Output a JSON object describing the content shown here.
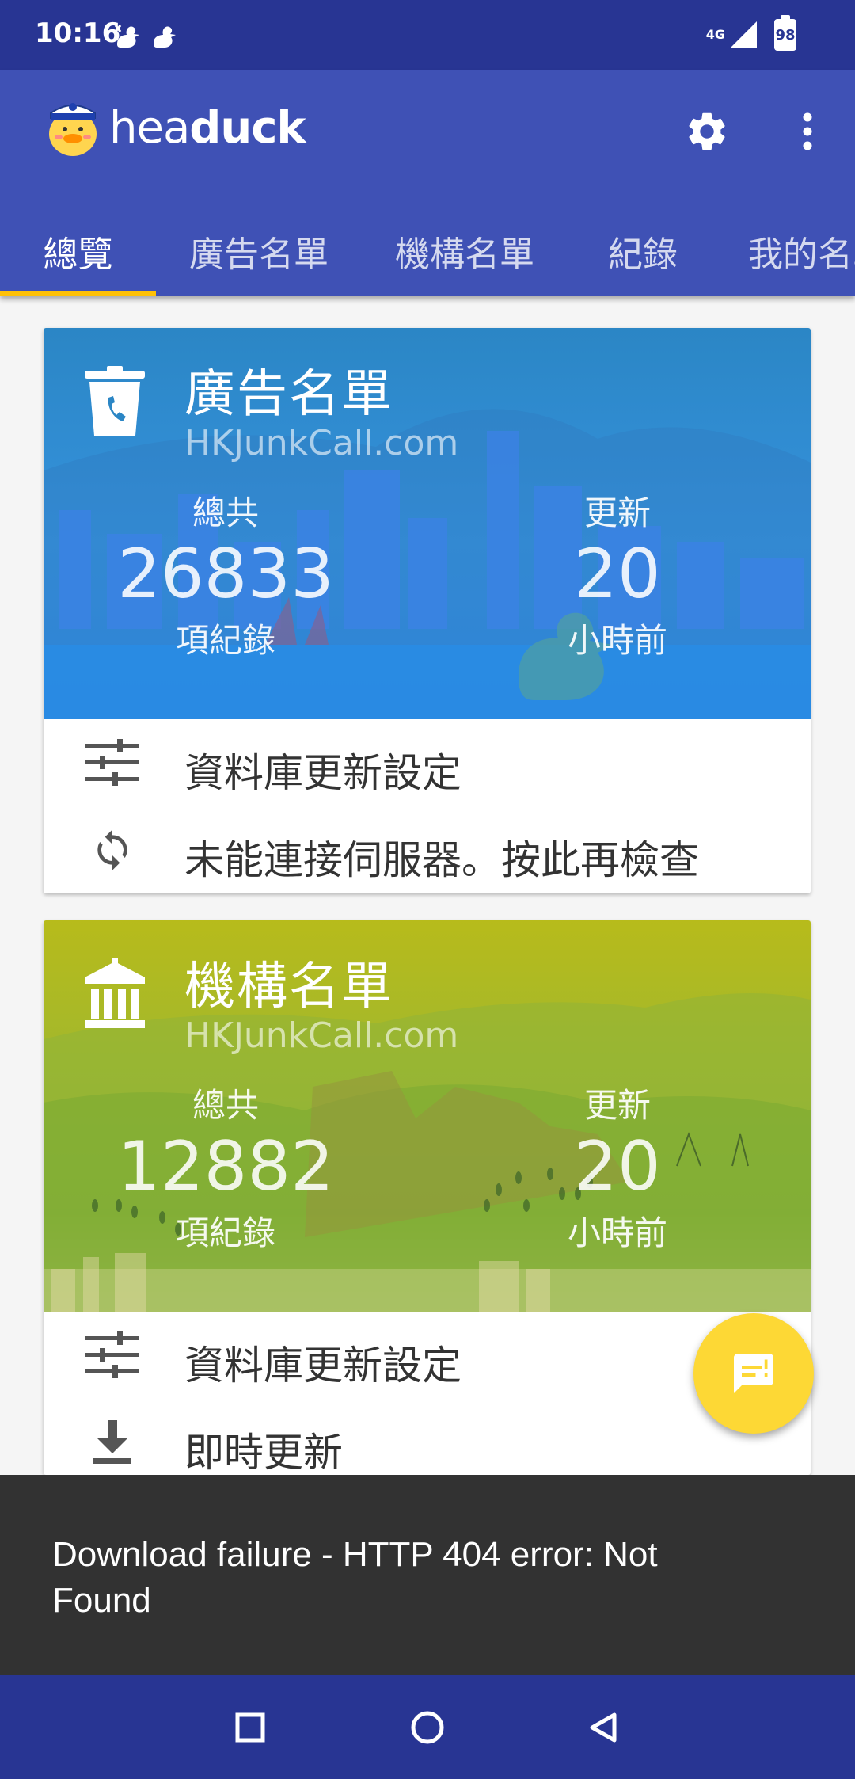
{
  "status_bar": {
    "time": "10:16",
    "network": "4G",
    "battery": "98"
  },
  "app": {
    "title_light": "hea",
    "title_bold": "duck"
  },
  "tabs": [
    {
      "label": "總覽",
      "active": true
    },
    {
      "label": "廣告名單",
      "active": false
    },
    {
      "label": "機構名單",
      "active": false
    },
    {
      "label": "紀錄",
      "active": false
    },
    {
      "label": "我的名單",
      "active": false
    }
  ],
  "cards": [
    {
      "title": "廣告名單",
      "subtitle": "HKJunkCall.com",
      "total_label": "總共",
      "total_value": "26833",
      "total_unit": "項紀錄",
      "update_label": "更新",
      "update_value": "20",
      "update_unit": "小時前",
      "actions": [
        {
          "icon": "tune-icon",
          "label": "資料庫更新設定"
        },
        {
          "icon": "sync-icon",
          "label": "未能連接伺服器。按此再檢查"
        }
      ]
    },
    {
      "title": "機構名單",
      "subtitle": "HKJunkCall.com",
      "total_label": "總共",
      "total_value": "12882",
      "total_unit": "項紀錄",
      "update_label": "更新",
      "update_value": "20",
      "update_unit": "小時前",
      "actions": [
        {
          "icon": "tune-icon",
          "label": "資料庫更新設定"
        },
        {
          "icon": "download-icon",
          "label": "即時更新"
        }
      ]
    }
  ],
  "snackbar": {
    "message": "Download failure - HTTP 404 error: Not Found"
  },
  "colors": {
    "primary": "#3f51b5",
    "primary_dark": "#283593",
    "accent": "#ffc107",
    "fab": "#fdd835",
    "snackbar": "#323232"
  }
}
